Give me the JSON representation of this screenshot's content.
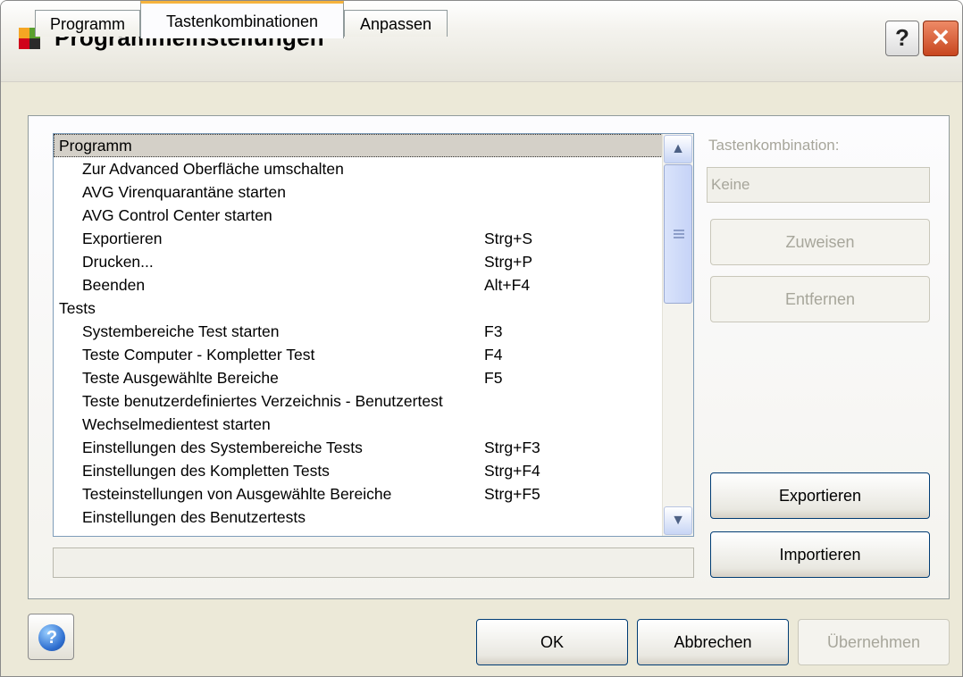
{
  "window": {
    "title": "Programmeinstellungen",
    "help_glyph": "?",
    "close_glyph": "✕"
  },
  "tabs": [
    {
      "label": "Programm",
      "active": false
    },
    {
      "label": "Tastenkombinationen",
      "active": true
    },
    {
      "label": "Anpassen",
      "active": false
    }
  ],
  "list": {
    "rows": [
      {
        "type": "group",
        "label": "Programm",
        "shortcut": "",
        "selected": true
      },
      {
        "type": "item",
        "label": "Zur Advanced Oberfläche umschalten",
        "shortcut": ""
      },
      {
        "type": "item",
        "label": "AVG Virenquarantäne starten",
        "shortcut": ""
      },
      {
        "type": "item",
        "label": "AVG Control Center starten",
        "shortcut": ""
      },
      {
        "type": "item",
        "label": "Exportieren",
        "shortcut": "Strg+S"
      },
      {
        "type": "item",
        "label": "Drucken...",
        "shortcut": "Strg+P"
      },
      {
        "type": "item",
        "label": "Beenden",
        "shortcut": "Alt+F4"
      },
      {
        "type": "group",
        "label": "Tests",
        "shortcut": ""
      },
      {
        "type": "item",
        "label": "Systembereiche Test starten",
        "shortcut": "F3"
      },
      {
        "type": "item",
        "label": "Teste Computer - Kompletter Test",
        "shortcut": "F4"
      },
      {
        "type": "item",
        "label": "Teste Ausgewählte Bereiche",
        "shortcut": "F5"
      },
      {
        "type": "item",
        "label": "Teste benutzerdefiniertes Verzeichnis - Benutzertest",
        "shortcut": ""
      },
      {
        "type": "item",
        "label": "Wechselmedientest starten",
        "shortcut": ""
      },
      {
        "type": "item",
        "label": "Einstellungen des Systembereiche Tests",
        "shortcut": "Strg+F3"
      },
      {
        "type": "item",
        "label": "Einstellungen des Kompletten Tests",
        "shortcut": "Strg+F4"
      },
      {
        "type": "item",
        "label": "Testeinstellungen von Ausgewählte Bereiche",
        "shortcut": "Strg+F5"
      },
      {
        "type": "item",
        "label": "Einstellungen des Benutzertests",
        "shortcut": ""
      }
    ],
    "status_text": ""
  },
  "right_panel": {
    "shortcut_label": "Tastenkombination:",
    "shortcut_value": "Keine",
    "assign_button": "Zuweisen",
    "remove_button": "Entfernen",
    "export_button": "Exportieren",
    "import_button": "Importieren"
  },
  "footer": {
    "ok_button": "OK",
    "cancel_button": "Abbrechen",
    "apply_button": "Übernehmen"
  },
  "colors": {
    "dialog_bg": "#ece9d8",
    "active_tab_accent": "#f6b33d",
    "close_button": "#c8461f",
    "disabled_text": "#a7a69b"
  }
}
